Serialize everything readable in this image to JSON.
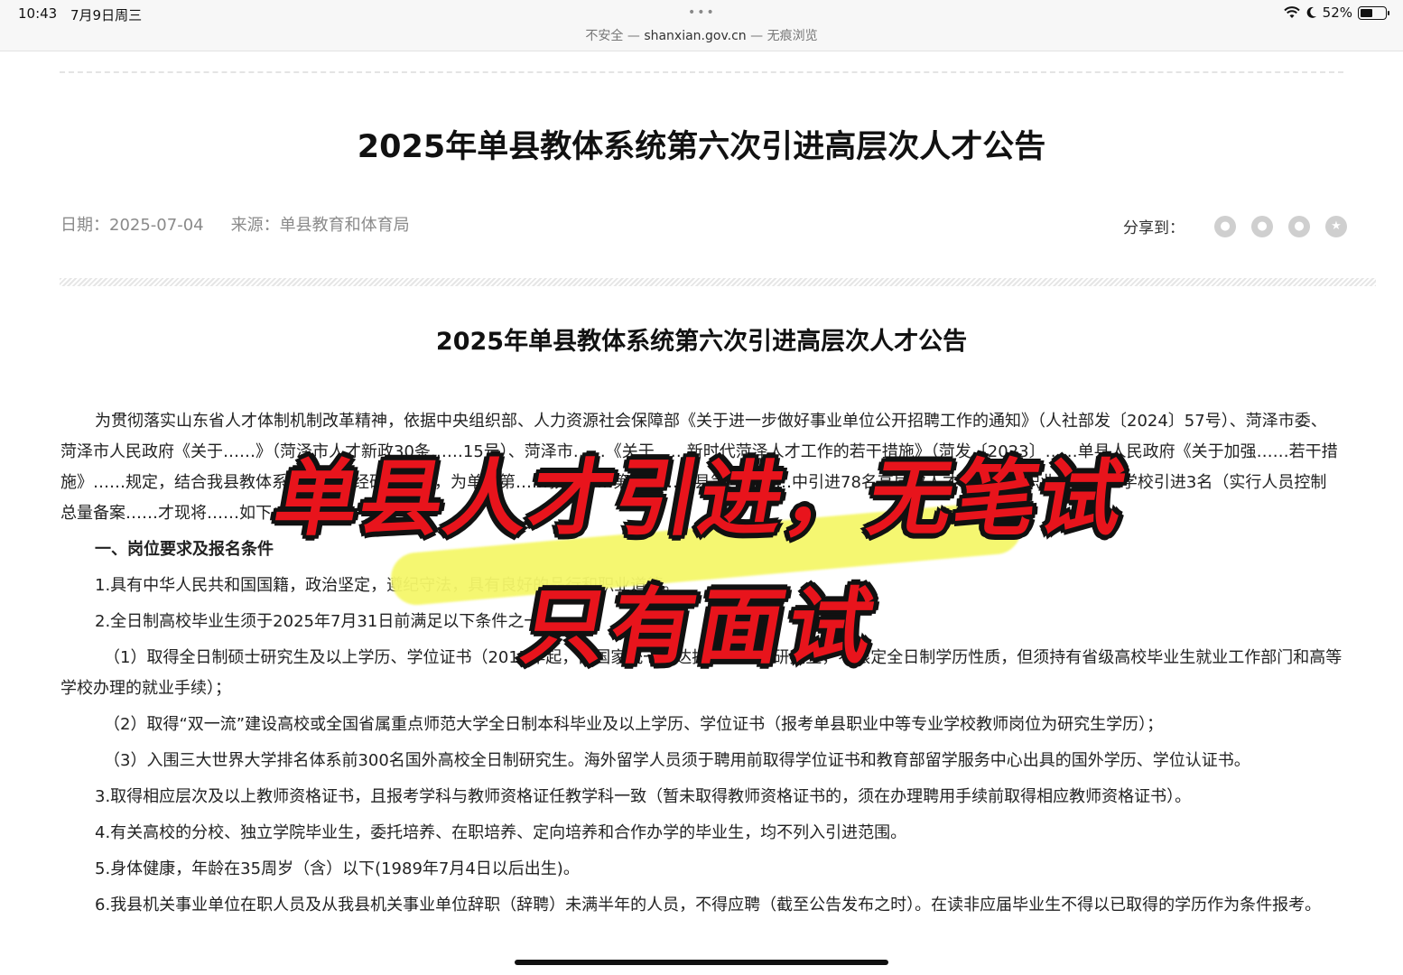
{
  "status_bar": {
    "time": "10:43",
    "date": "7月9日周三",
    "dots": "•••",
    "url_prefix": "不安全 — ",
    "url_host": "shanxian.gov.cn",
    "url_suffix": " — 无痕浏览",
    "battery": "52%",
    "battery_level": 0.52
  },
  "article": {
    "title": "2025年单县教体系统第六次引进高层次人才公告",
    "date": "日期：2025-07-04",
    "source": "来源：单县教育和体育局",
    "share_label": "分享到：",
    "share_icons": [
      "wechat-icon",
      "weibo-icon",
      "qq-icon",
      "qzone-icon"
    ]
  },
  "doc": {
    "title": "2025年单县教体系统第六次引进高层次人才公告",
    "intro": "为贯彻落实山东省人才体制机制改革精神，依据中央组织部、人力资源社会保障部《关于进一步做好事业单位公开招聘工作的通知》（人社部发〔2024〕57号）、菏泽市委、菏泽市人民政府《关于……》（菏泽市人才新政30条……15号）、菏泽市……《关于……新时代菏泽人才工作的若干措施》（菏发〔2023〕……单县人民政府《关于加强……若干措施》……规定，结合我县教体系统实际，经研究决定，为单县第……教育……第一……单县第一中……中引进78名高层次人才，为单县职业中等专业学校引进3名（实行人员控制总量备案……才现将……如下：",
    "section1": "一、岗位要求及报名条件",
    "item1": "1.具有中华人民共和国国籍，政治坚定，遵纪守法，具有良好的品行和职业道德。",
    "item2": "2.全日制高校毕业生须于2025年7月31日前满足以下条件之一：",
    "item2_1": "（1）取得全日制硕士研究生及以上学历、学位证书（2017年起，由国家统一下达招生计划的研究生，不限定全日制学历性质，但须持有省级高校毕业生就业工作部门和高等学校办理的就业手续）；",
    "item2_2": "（2）取得“双一流”建设高校或全国省属重点师范大学全日制本科毕业及以上学历、学位证书（报考单县职业中等专业学校教师岗位为研究生学历）；",
    "item2_3": "（3）入围三大世界大学排名体系前300名国外高校全日制研究生。海外留学人员须于聘用前取得学位证书和教育部留学服务中心出具的国外学历、学位认证书。",
    "item3": "3.取得相应层次及以上教师资格证书，且报考学科与教师资格证任教学科一致（暂未取得教师资格证书的，须在办理聘用手续前取得相应教师资格证书）。",
    "item4": "4.有关高校的分校、独立学院毕业生，委托培养、在职培养、定向培养和合作办学的毕业生，均不列入引进范围。",
    "item5": "5.身体健康，年龄在35周岁（含）以下(1989年7月4日以后出生)。",
    "item6": "6.我县机关事业单位在职人员及从我县机关事业单位辞职（辞聘）未满半年的人员，不得应聘（截至公告发布之时）。在读非应届毕业生不得以已取得的学历作为条件报考。"
  },
  "overlay": {
    "line1": "单县人才引进，无笔试",
    "line2": "只有面试",
    "color": "#e8141c",
    "highlight_color": "#f5f76a"
  }
}
